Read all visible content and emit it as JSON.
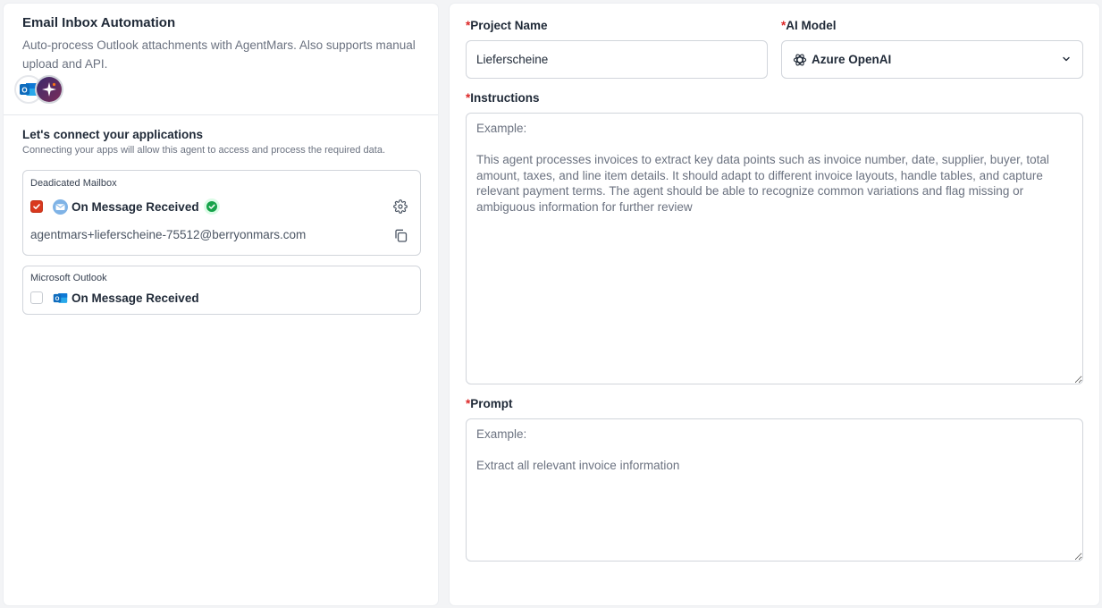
{
  "automation": {
    "title": "Email Inbox Automation",
    "description": "Auto-process Outlook attachments with AgentMars. Also supports manual upload and API.",
    "app_icons": [
      "outlook-icon",
      "agentmars-icon"
    ]
  },
  "connect": {
    "title": "Let's connect your applications",
    "subtitle": "Connecting your apps will allow this agent to access and process the required data."
  },
  "connections": [
    {
      "label": "Deadicated Mailbox",
      "trigger": "On Message Received",
      "checked": true,
      "connected": true,
      "icon": "mail-icon",
      "email": "agentmars+lieferscheine-75512@berryonmars.com"
    },
    {
      "label": "Microsoft Outlook",
      "trigger": "On Message Received",
      "checked": false,
      "icon": "outlook-icon"
    }
  ],
  "form": {
    "project_name": {
      "required_mark": "*",
      "label": "Project Name",
      "value": "Lieferscheine"
    },
    "ai_model": {
      "required_mark": "*",
      "label": "AI Model",
      "value": "Azure OpenAI",
      "icon": "openai-icon"
    },
    "instructions": {
      "required_mark": "*",
      "label": "Instructions",
      "placeholder": "Example:\n\nThis agent processes invoices to extract key data points such as invoice number, date, supplier, buyer, total amount, taxes, and line item details. It should adapt to different invoice layouts, handle tables, and capture relevant payment terms. The agent should be able to recognize common variations and flag missing or ambiguous information for further review"
    },
    "prompt": {
      "required_mark": "*",
      "label": "Prompt",
      "placeholder": "Example:\n\nExtract all relevant invoice information"
    }
  },
  "colors": {
    "accent": "#d9381e",
    "required": "#dc2626",
    "success": "#16a34a",
    "outlook_blue": "#0f6cbd",
    "border": "#d1d5db"
  }
}
